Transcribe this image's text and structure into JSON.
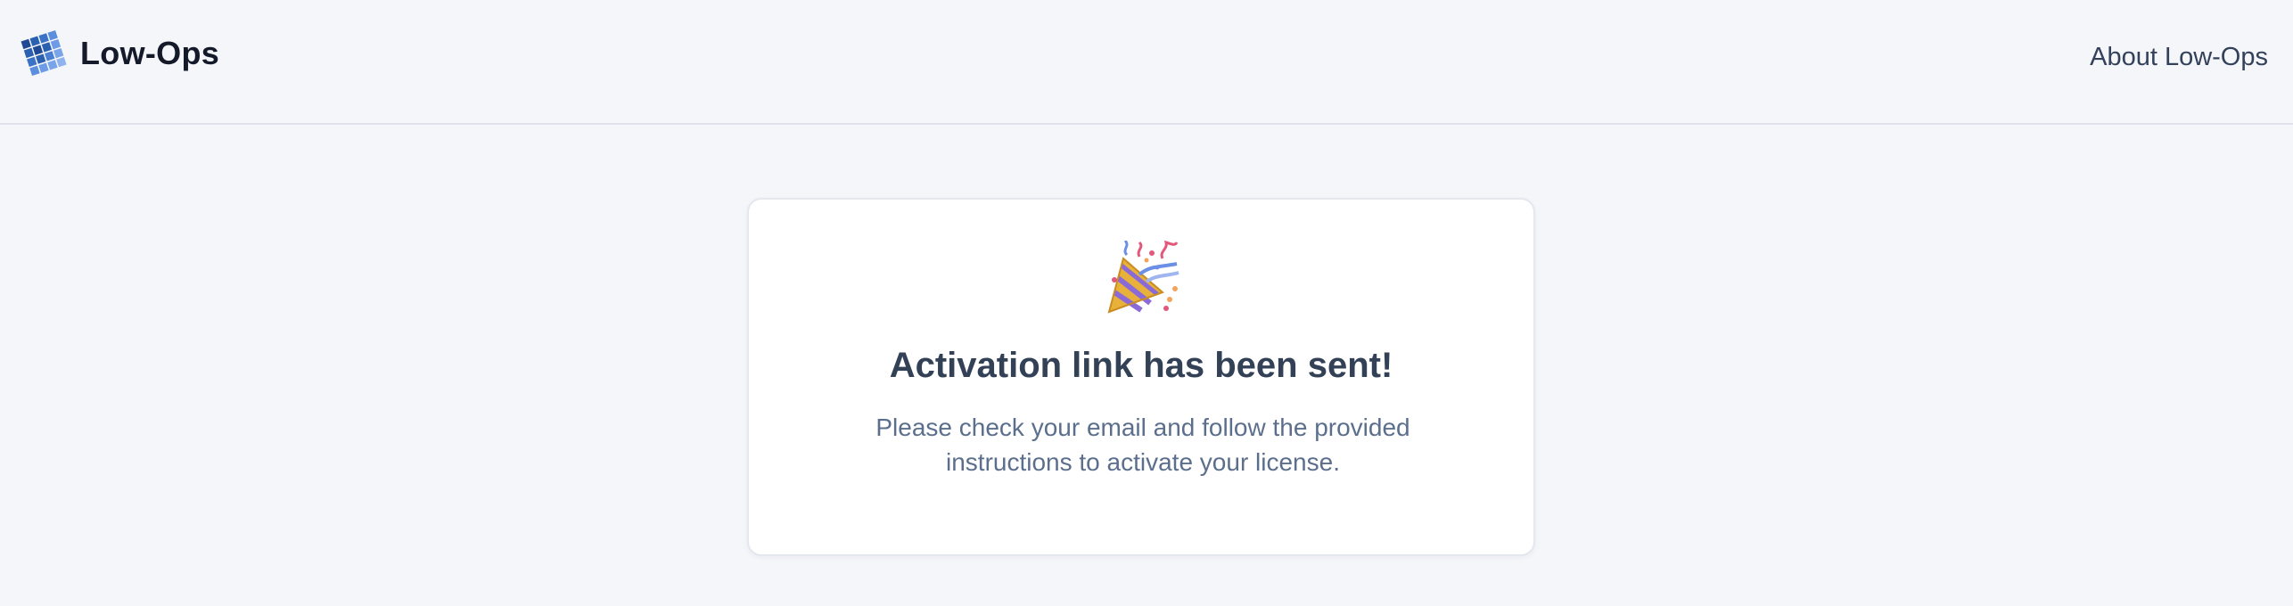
{
  "header": {
    "brand_name": "Low-Ops",
    "logo_icon": "grid-logo-icon",
    "nav_about_label": "About Low-Ops"
  },
  "card": {
    "icon": "party-popper-icon",
    "title": "Activation link has been sent!",
    "message": "Please check your email and follow the provided instructions to activate your license."
  },
  "colors": {
    "background": "#f5f6fa",
    "card_background": "#ffffff",
    "title": "#334156",
    "body_text": "#5b6f8d",
    "brand_text": "#141a2a",
    "logo_dark": "#1f4a93",
    "logo_light": "#7aa4ea"
  }
}
